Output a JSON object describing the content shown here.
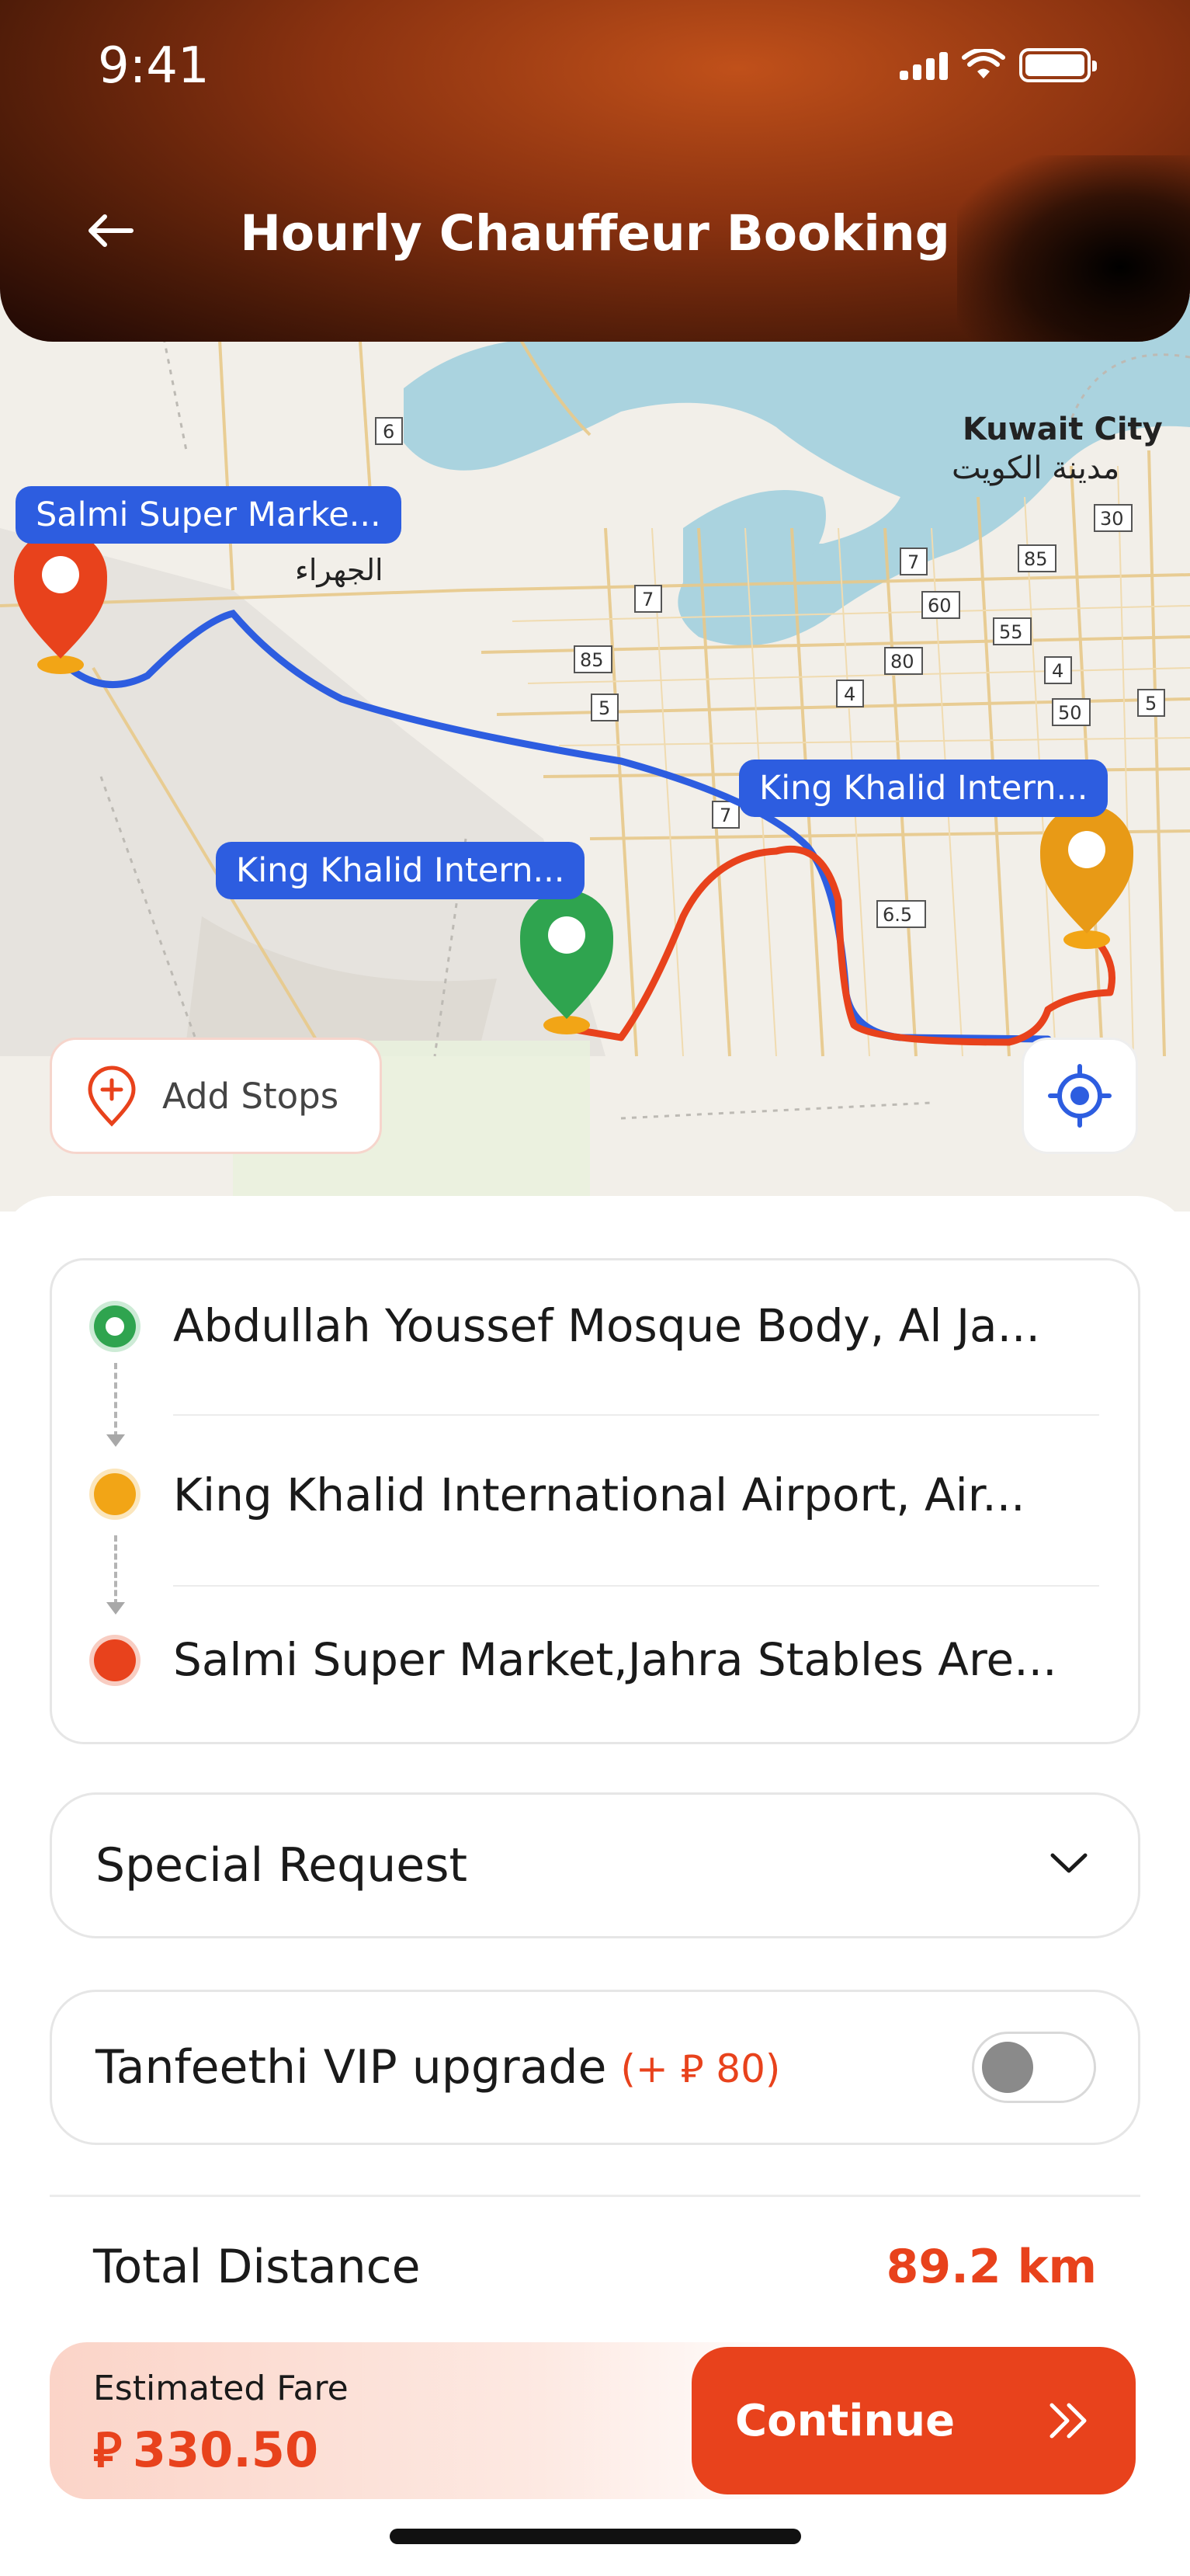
{
  "status_bar": {
    "time": "9:41"
  },
  "header": {
    "title": "Hourly Chauffeur Booking"
  },
  "map": {
    "labels": {
      "pickup": "Salmi Super Marke...",
      "airport_right": "King Khalid Intern...",
      "airport_left": "King Khalid Intern..."
    },
    "city": {
      "name_en": "Kuwait City",
      "name_ar": "مدينة الكويت"
    },
    "town_ar": "الجهراء",
    "road_numbers": [
      "6",
      "7",
      "7",
      "85",
      "5",
      "80",
      "4",
      "60",
      "55",
      "4",
      "50",
      "5",
      "85",
      "30",
      "6.5",
      "7"
    ],
    "add_stops_label": "Add Stops"
  },
  "route": {
    "stops": [
      {
        "text": "Abdullah Youssef Mosque Body, Al Ja...",
        "color": "#2fa44f"
      },
      {
        "text": "King Khalid International Airport, Air...",
        "color": "#f2a516"
      },
      {
        "text": "Salmi Super Market,Jahra Stables Are...",
        "color": "#e8421c"
      }
    ]
  },
  "special_request": {
    "label": "Special Request"
  },
  "vip": {
    "label": "Tanfeethi VIP upgrade",
    "extra": "(+ ⃁ 80)",
    "enabled": false
  },
  "distance": {
    "label": "Total Distance",
    "value": "89.2 km"
  },
  "fare": {
    "label": "Estimated Fare",
    "value": "330.50",
    "currency": "⃁"
  },
  "continue_label": "Continue",
  "colors": {
    "accent": "#e8421c",
    "pin_red": "#e8421c",
    "pin_green": "#2fa44f",
    "pin_orange": "#e89a16",
    "route_blue": "#2d5de0"
  }
}
